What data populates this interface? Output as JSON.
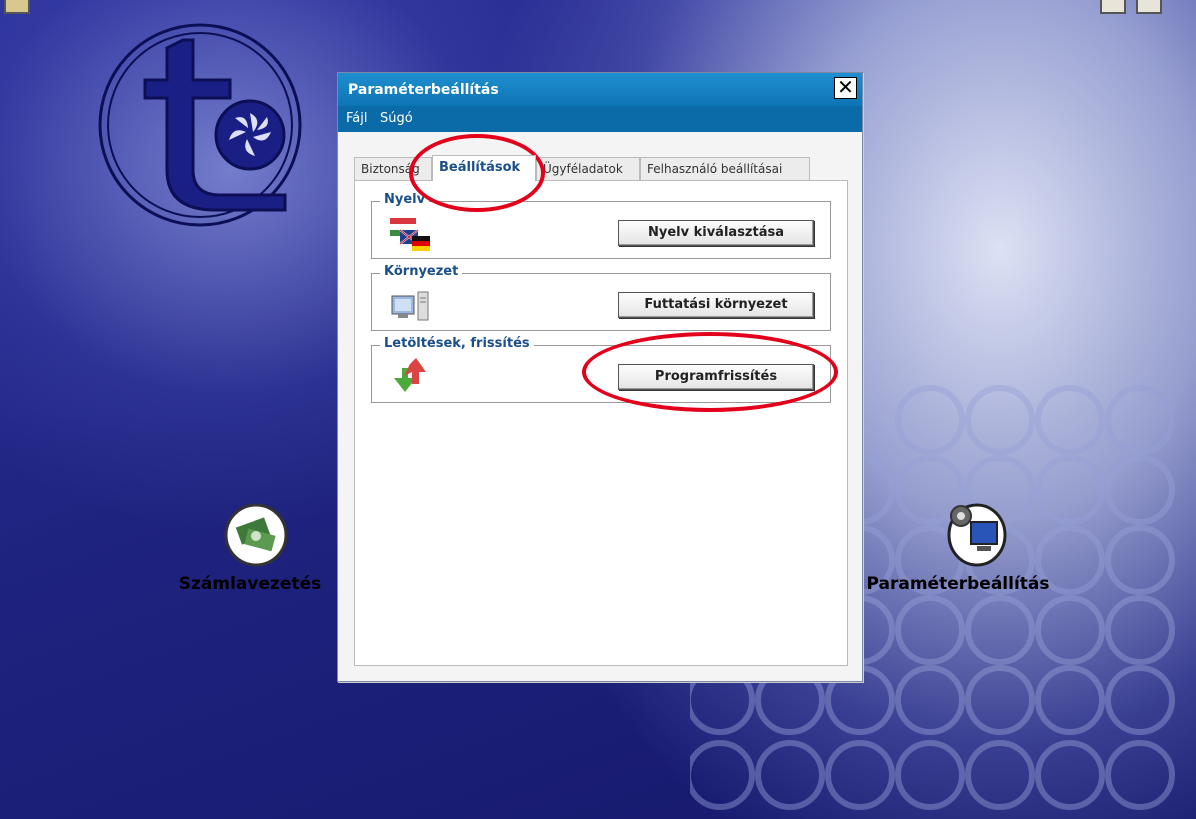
{
  "desktop": {
    "left_icon_label": "Számlavezetés",
    "right_icon_label": "Paraméterbeállítás"
  },
  "dialog": {
    "title": "Paraméterbeállítás",
    "close_symbol": "✕",
    "menu": {
      "file": "Fájl",
      "help": "Súgó"
    },
    "tabs": [
      {
        "label": "Biztonság"
      },
      {
        "label": "Beállítások"
      },
      {
        "label": "Ügyféladatok"
      },
      {
        "label": "Felhasználó beállításai"
      }
    ],
    "groups": {
      "language": {
        "legend": "Nyelv",
        "button": "Nyelv kiválasztása",
        "icon": "flags-icon"
      },
      "environment": {
        "legend": "Környezet",
        "button": "Futtatási környezet",
        "icon": "computer-icon"
      },
      "updates": {
        "legend": "Letöltések, frissítés",
        "button": "Programfrissítés",
        "icon": "update-arrows-icon"
      }
    }
  },
  "colors": {
    "titlebar": "#0d74b5",
    "menubar": "#0b6aa8",
    "legend_text": "#1a4f8a",
    "annotation": "#e3001b"
  }
}
